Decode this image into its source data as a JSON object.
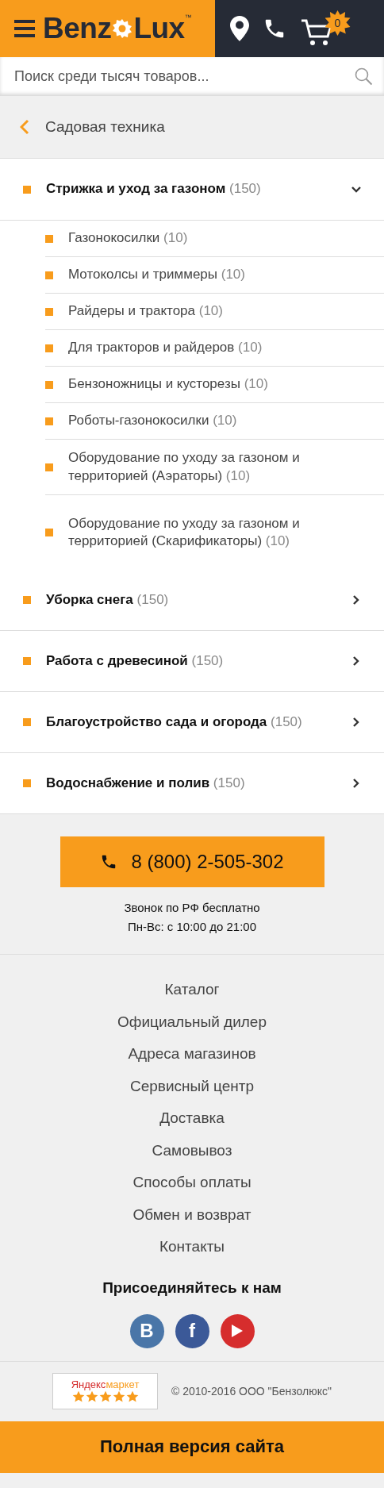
{
  "header": {
    "logo": {
      "left": "Benz",
      "right": "Lux",
      "mark": "™"
    },
    "cart_count": "0"
  },
  "search": {
    "placeholder": "Поиск среди тысяч товаров..."
  },
  "breadcrumb": {
    "label": "Садовая техника"
  },
  "categories": [
    {
      "name": "Стрижка и уход за газоном",
      "count": "(150)",
      "expanded": true,
      "children": [
        {
          "name": "Газонокосилки",
          "count": "(10)"
        },
        {
          "name": "Мотоколсы и триммеры",
          "count": "(10)"
        },
        {
          "name": "Райдеры и трактора",
          "count": "(10)"
        },
        {
          "name": "Для тракторов и райдеров",
          "count": "(10)"
        },
        {
          "name": "Бензоножницы и кусторезы",
          "count": "(10)"
        },
        {
          "name": "Роботы-газонокосилки",
          "count": "(10)"
        },
        {
          "name": "Оборудование по уходу за газоном и территорией (Аэраторы)",
          "count": "(10)"
        },
        {
          "name": "Оборудование по уходу за газоном и территорией (Скарификаторы)",
          "count": "(10)"
        }
      ]
    },
    {
      "name": "Уборка снега",
      "count": "(150)",
      "expanded": false
    },
    {
      "name": "Работа с древесиной",
      "count": "(150)",
      "expanded": false
    },
    {
      "name": "Благоустройство сада и огорода",
      "count": "(150)",
      "expanded": false
    },
    {
      "name": "Водоснабжение и полив",
      "count": "(150)",
      "expanded": false
    }
  ],
  "contact": {
    "phone": "8 (800) 2-505-302",
    "notes": [
      "Звонок по РФ бесплатно",
      "Пн-Вс: с 10:00 до 21:00"
    ]
  },
  "footer_links": [
    "Каталог",
    "Официальный дилер",
    "Адреса магазинов",
    "Сервисный центр",
    "Доставка",
    "Самовывоз",
    "Способы оплаты",
    "Обмен и возврат",
    "Контакты"
  ],
  "social": {
    "heading": "Присоединяйтесь к нам",
    "networks": [
      {
        "kind": "vk",
        "label": "B",
        "color": "#4a76a8"
      },
      {
        "kind": "facebook",
        "label": "f",
        "color": "#3b5998"
      },
      {
        "kind": "youtube",
        "color": "#d62d2d"
      }
    ]
  },
  "yandex_badge": {
    "brand": "Яндекс",
    "product": "маркет",
    "stars": 5
  },
  "copyright": "© 2010-2016 ООО \"Бензолюкс\"",
  "full_version": "Полная версия сайта"
}
